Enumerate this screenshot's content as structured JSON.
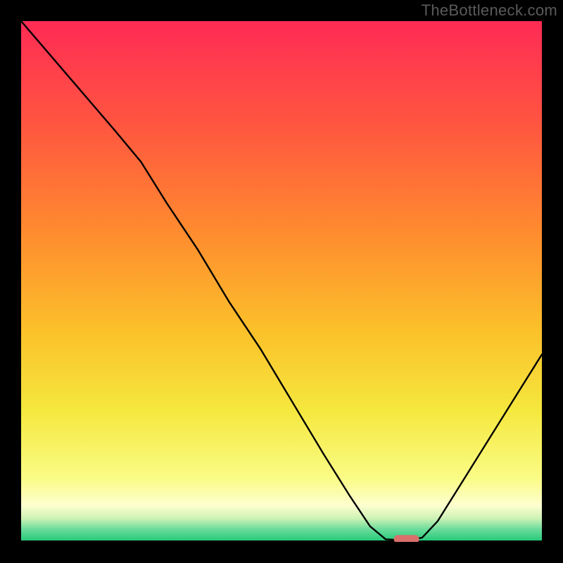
{
  "watermark": "TheBottleneck.com",
  "chart_data": {
    "type": "line",
    "title": "",
    "xlabel": "",
    "ylabel": "",
    "xlim": [
      0,
      100
    ],
    "ylim": [
      0,
      100
    ],
    "grid": false,
    "legend": false,
    "background_gradient": {
      "stops": [
        {
          "offset": 0.0,
          "color": "#ff2b55"
        },
        {
          "offset": 0.2,
          "color": "#ff5640"
        },
        {
          "offset": 0.4,
          "color": "#ff8a2f"
        },
        {
          "offset": 0.6,
          "color": "#fbc22a"
        },
        {
          "offset": 0.75,
          "color": "#f5e83f"
        },
        {
          "offset": 0.88,
          "color": "#fafc87"
        },
        {
          "offset": 0.93,
          "color": "#fefed0"
        },
        {
          "offset": 0.955,
          "color": "#cdf2b6"
        },
        {
          "offset": 0.975,
          "color": "#6ddc9c"
        },
        {
          "offset": 1.0,
          "color": "#1fc877"
        }
      ]
    },
    "curve": {
      "description": "Bottleneck percentage curve with minimum indicating balanced hardware match",
      "points": [
        {
          "x": 0,
          "y": 100
        },
        {
          "x": 6,
          "y": 93
        },
        {
          "x": 12,
          "y": 86
        },
        {
          "x": 18,
          "y": 79
        },
        {
          "x": 23,
          "y": 73
        },
        {
          "x": 28,
          "y": 65
        },
        {
          "x": 34,
          "y": 56
        },
        {
          "x": 40,
          "y": 46
        },
        {
          "x": 46,
          "y": 37
        },
        {
          "x": 52,
          "y": 27
        },
        {
          "x": 58,
          "y": 17
        },
        {
          "x": 63,
          "y": 9
        },
        {
          "x": 67,
          "y": 3
        },
        {
          "x": 70,
          "y": 0.5
        },
        {
          "x": 74,
          "y": 0.3
        },
        {
          "x": 77,
          "y": 0.8
        },
        {
          "x": 80,
          "y": 4
        },
        {
          "x": 85,
          "y": 12
        },
        {
          "x": 90,
          "y": 20
        },
        {
          "x": 95,
          "y": 28
        },
        {
          "x": 100,
          "y": 36
        }
      ]
    },
    "marker": {
      "x": 74,
      "y": 0.5,
      "color": "#d9706b",
      "shape": "pill"
    }
  }
}
